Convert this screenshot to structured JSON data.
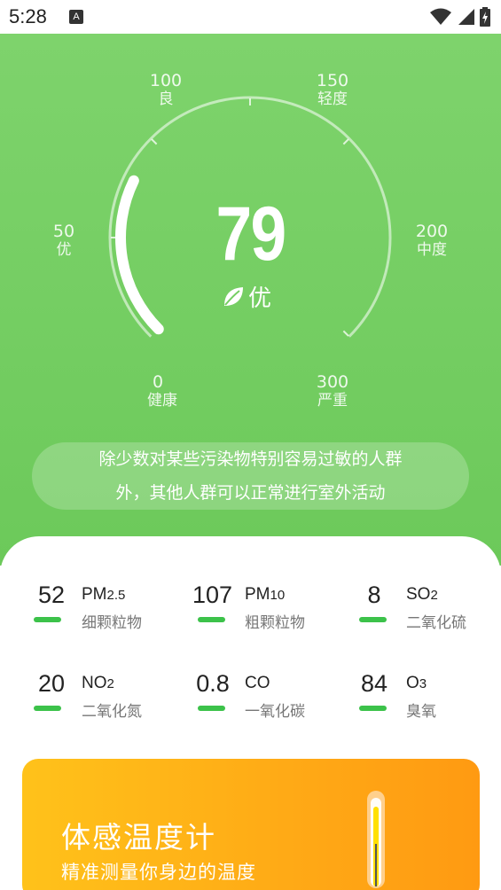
{
  "status_bar": {
    "time": "5:28",
    "notification_icon_letter": "A",
    "icons": [
      "wifi-icon",
      "signal-icon",
      "battery-icon"
    ]
  },
  "gauge": {
    "aqi": "79",
    "level": "优",
    "max": 300,
    "scale": [
      {
        "value": "0",
        "label": "健康"
      },
      {
        "value": "50",
        "label": "优"
      },
      {
        "value": "100",
        "label": "良"
      },
      {
        "value": "150",
        "label": "轻度"
      },
      {
        "value": "200",
        "label": "中度"
      },
      {
        "value": "300",
        "label": "严重"
      }
    ]
  },
  "advice": {
    "line1": "除少数对某些污染物特别容易过敏的人群",
    "line2": "外，其他人群可以正常进行室外活动"
  },
  "pollutants": [
    {
      "value": "52",
      "code": "PM",
      "sub": "2.5",
      "name": "细颗粒物"
    },
    {
      "value": "107",
      "code": "PM",
      "sub": "10",
      "name": "粗颗粒物"
    },
    {
      "value": "8",
      "code": "SO",
      "sub": "2",
      "name": "二氧化硫"
    },
    {
      "value": "20",
      "code": "NO",
      "sub": "2",
      "name": "二氧化氮"
    },
    {
      "value": "0.8",
      "code": "CO",
      "sub": "",
      "name": "一氧化碳"
    },
    {
      "value": "84",
      "code": "O",
      "sub": "3",
      "name": "臭氧"
    }
  ],
  "banner": {
    "title": "体感温度计",
    "subtitle": "精准测量你身边的温度"
  },
  "colors": {
    "hero_green": "#74ce62",
    "indicator_green": "#3cc24a",
    "banner_orange": "#ffab16"
  }
}
